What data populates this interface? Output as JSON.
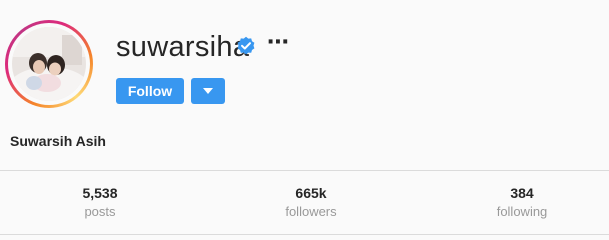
{
  "profile": {
    "username": "suwarsiha",
    "full_name": "Suwarsih Asih",
    "verified_icon": "verified-badge-icon",
    "more_label": "⋯",
    "avatar": "profile-photo"
  },
  "actions": {
    "follow_label": "Follow",
    "dropdown_icon": "chevron-down-icon"
  },
  "stats": [
    {
      "value": "5,538",
      "label": "posts"
    },
    {
      "value": "665k",
      "label": "followers"
    },
    {
      "value": "384",
      "label": "following"
    }
  ],
  "colors": {
    "accent": "#3897f0",
    "text": "#262626",
    "muted": "#999999",
    "background": "#fafafa"
  }
}
